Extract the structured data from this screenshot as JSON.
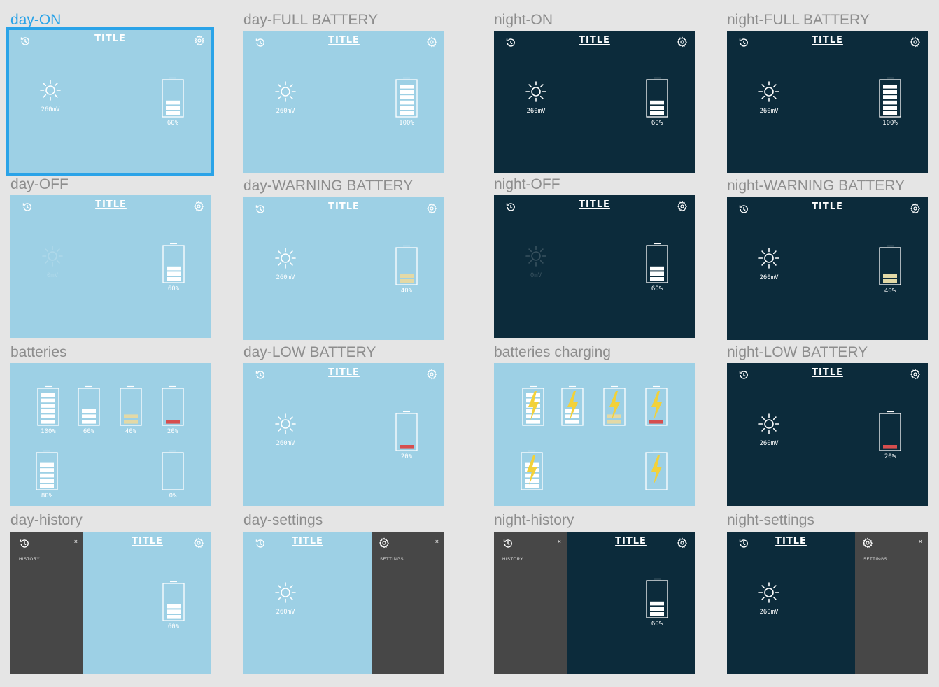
{
  "frames": {
    "day_on": {
      "label": "day-ON",
      "title": "TITLE",
      "mv": "260mV",
      "pct": "60%"
    },
    "day_full": {
      "label": "day-FULL BATTERY",
      "title": "TITLE",
      "mv": "260mV",
      "pct": "100%"
    },
    "night_on": {
      "label": "night-ON",
      "title": "TITLE",
      "mv": "260mV",
      "pct": "60%"
    },
    "night_full": {
      "label": "night-FULL BATTERY",
      "title": "TITLE",
      "mv": "260mV",
      "pct": "100%"
    },
    "day_off": {
      "label": "day-OFF",
      "title": "TITLE",
      "mv": "0mV",
      "pct": "60%"
    },
    "day_warning": {
      "label": "day-WARNING BATTERY",
      "title": "TITLE",
      "mv": "260mV",
      "pct": "40%"
    },
    "night_off": {
      "label": "night-OFF",
      "title": "TITLE",
      "mv": "0mV",
      "pct": "60%"
    },
    "night_warning": {
      "label": "night-WARNING BATTERY",
      "title": "TITLE",
      "mv": "260mV",
      "pct": "40%"
    },
    "batteries": {
      "label": "batteries",
      "pcts": [
        "100%",
        "60%",
        "40%",
        "20%",
        "80%",
        "0%"
      ]
    },
    "day_low": {
      "label": "day-LOW BATTERY",
      "title": "TITLE",
      "mv": "260mV",
      "pct": "20%"
    },
    "batteries_charging": {
      "label": "batteries charging"
    },
    "night_low": {
      "label": "night-LOW BATTERY",
      "title": "TITLE",
      "mv": "260mV",
      "pct": "20%"
    },
    "day_history": {
      "label": "day-history",
      "title": "TITLE",
      "panel_title": "HISTORY",
      "pct": "60%",
      "close": "×"
    },
    "day_settings": {
      "label": "day-settings",
      "title": "TITLE",
      "panel_title": "SETTINGS",
      "mv": "260mV",
      "close": "×"
    },
    "night_history": {
      "label": "night-history",
      "title": "TITLE",
      "panel_title": "HISTORY",
      "pct": "60%",
      "close": "×"
    },
    "night_settings": {
      "label": "night-settings",
      "title": "TITLE",
      "panel_title": "SETTINGS",
      "mv": "260mV",
      "close": "×"
    }
  },
  "colors": {
    "day_bg": "#9dd0e5",
    "night_bg": "#0c2b3b",
    "panel_bg": "#474747",
    "selected": "#2aa3e8",
    "warning_fill": "#e3d9a6",
    "low_fill": "#d64e4e",
    "bolt": "#f2d13a"
  },
  "icons": [
    "history-icon",
    "gear-icon",
    "sun-icon",
    "battery-icon",
    "lightning-icon",
    "close-icon"
  ],
  "battery_levels": {
    "full": 6,
    "normal": 3,
    "eighty": 5,
    "warning": 2,
    "low": 1,
    "empty": 0
  }
}
